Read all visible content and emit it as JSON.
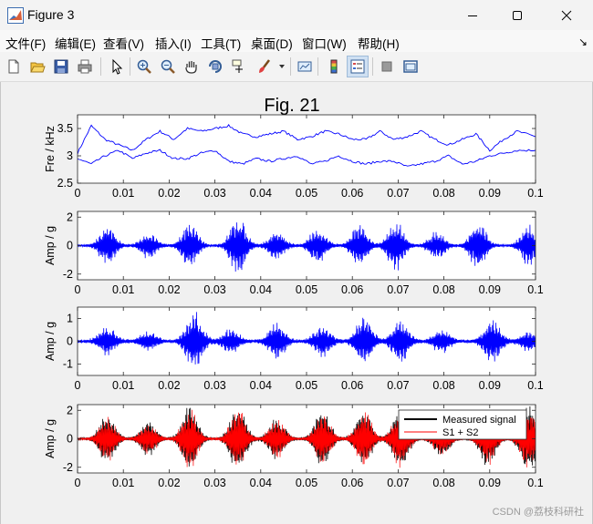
{
  "window": {
    "title": "Figure 3",
    "controls": {
      "minimize": "minimize-icon",
      "maximize": "maximize-icon",
      "close": "close-icon"
    }
  },
  "menu": [
    "文件(F)",
    "编辑(E)",
    "查看(V)",
    "插入(I)",
    "工具(T)",
    "桌面(D)",
    "窗口(W)",
    "帮助(H)"
  ],
  "toolbar": {
    "icons": [
      "new-figure-icon",
      "open-file-icon",
      "save-icon",
      "print-icon",
      "pointer-icon",
      "zoom-in-icon",
      "zoom-out-icon",
      "pan-icon",
      "rotate-3d-icon",
      "data-cursor-icon",
      "brush-icon",
      "brush-dropdown-icon",
      "link-plot-icon",
      "colorbar-icon",
      "legend-icon",
      "hide-plot-tools-icon",
      "show-plot-tools-icon"
    ]
  },
  "figure_title": "Fig. 21",
  "watermark": "CSDN @荔枝科研社",
  "chart_data": [
    {
      "type": "line",
      "ylabel": "Fre / kHz",
      "xlim": [
        0,
        0.1
      ],
      "ylim": [
        2.5,
        3.75
      ],
      "xticks": [
        "0",
        "0.01",
        "0.02",
        "0.03",
        "0.04",
        "0.05",
        "0.06",
        "0.07",
        "0.08",
        "0.09",
        "0.1"
      ],
      "yticks": [
        "2.5",
        "3",
        "3.5"
      ],
      "series": [
        {
          "color": "#0000ff",
          "x": [
            0,
            0.003,
            0.006,
            0.009,
            0.012,
            0.015,
            0.018,
            0.021,
            0.024,
            0.027,
            0.03,
            0.033,
            0.036,
            0.039,
            0.042,
            0.045,
            0.048,
            0.051,
            0.054,
            0.057,
            0.06,
            0.063,
            0.066,
            0.069,
            0.072,
            0.075,
            0.078,
            0.081,
            0.084,
            0.087,
            0.09,
            0.093,
            0.096,
            0.1
          ],
          "y": [
            3.05,
            3.55,
            3.3,
            3.2,
            3.1,
            3.3,
            3.45,
            3.3,
            3.5,
            3.45,
            3.5,
            3.55,
            3.4,
            3.35,
            3.4,
            3.45,
            3.3,
            3.35,
            3.45,
            3.4,
            3.3,
            3.3,
            3.45,
            3.3,
            3.35,
            3.45,
            3.3,
            3.2,
            3.3,
            3.4,
            3.1,
            3.3,
            3.45,
            3.35
          ]
        },
        {
          "color": "#0000ff",
          "x": [
            0,
            0.003,
            0.006,
            0.009,
            0.012,
            0.015,
            0.018,
            0.021,
            0.024,
            0.027,
            0.03,
            0.033,
            0.036,
            0.039,
            0.042,
            0.045,
            0.048,
            0.051,
            0.054,
            0.057,
            0.06,
            0.063,
            0.066,
            0.069,
            0.072,
            0.075,
            0.078,
            0.081,
            0.084,
            0.087,
            0.09,
            0.093,
            0.096,
            0.1
          ],
          "y": [
            2.95,
            2.85,
            3.0,
            3.1,
            2.95,
            3.05,
            3.1,
            2.95,
            2.95,
            3.05,
            3.1,
            2.9,
            2.85,
            2.95,
            2.9,
            2.95,
            3.0,
            2.85,
            2.9,
            3.0,
            2.9,
            2.85,
            2.9,
            2.9,
            2.8,
            2.85,
            2.9,
            3.0,
            2.85,
            2.9,
            3.0,
            3.05,
            3.1,
            3.1
          ]
        }
      ]
    },
    {
      "type": "line",
      "ylabel": "Amp / g",
      "xlim": [
        0,
        0.1
      ],
      "ylim": [
        -2.4,
        2.4
      ],
      "xticks": [
        "0",
        "0.01",
        "0.02",
        "0.03",
        "0.04",
        "0.05",
        "0.06",
        "0.07",
        "0.08",
        "0.09",
        "0.1"
      ],
      "yticks": [
        "-2",
        "0",
        "2"
      ],
      "series": [
        {
          "color": "#0000ff",
          "bursts": [
            {
              "x": 0.0065,
              "peak": 1.4
            },
            {
              "x": 0.0155,
              "peak": 0.9
            },
            {
              "x": 0.0245,
              "peak": 1.6
            },
            {
              "x": 0.035,
              "peak": 2.1
            },
            {
              "x": 0.0435,
              "peak": 1.0
            },
            {
              "x": 0.0525,
              "peak": 1.3
            },
            {
              "x": 0.0615,
              "peak": 1.5
            },
            {
              "x": 0.0695,
              "peak": 1.8
            },
            {
              "x": 0.0785,
              "peak": 1.0
            },
            {
              "x": 0.0875,
              "peak": 1.7
            },
            {
              "x": 0.0985,
              "peak": 1.4
            }
          ]
        }
      ]
    },
    {
      "type": "line",
      "ylabel": "Amp / g",
      "xlim": [
        0,
        0.1
      ],
      "ylim": [
        -1.5,
        1.5
      ],
      "xticks": [
        "0",
        "0.01",
        "0.02",
        "0.03",
        "0.04",
        "0.05",
        "0.06",
        "0.07",
        "0.08",
        "0.09",
        "0.1"
      ],
      "yticks": [
        "-1",
        "0",
        "1"
      ],
      "series": [
        {
          "color": "#0000ff",
          "bursts": [
            {
              "x": 0.0065,
              "peak": 0.6
            },
            {
              "x": 0.0155,
              "peak": 0.4
            },
            {
              "x": 0.0255,
              "peak": 1.3
            },
            {
              "x": 0.0335,
              "peak": 0.5
            },
            {
              "x": 0.0435,
              "peak": 0.8
            },
            {
              "x": 0.0535,
              "peak": 0.7
            },
            {
              "x": 0.0625,
              "peak": 1.1
            },
            {
              "x": 0.0705,
              "peak": 0.9
            },
            {
              "x": 0.0795,
              "peak": 0.5
            },
            {
              "x": 0.0905,
              "peak": 1.0
            },
            {
              "x": 0.0985,
              "peak": 0.4
            }
          ]
        }
      ]
    },
    {
      "type": "line",
      "ylabel": "Amp / g",
      "xlim": [
        0,
        0.1
      ],
      "ylim": [
        -2.4,
        2.4
      ],
      "xticks": [
        "0",
        "0.01",
        "0.02",
        "0.03",
        "0.04",
        "0.05",
        "0.06",
        "0.07",
        "0.08",
        "0.09",
        "0.1"
      ],
      "yticks": [
        "-2",
        "0",
        "2"
      ],
      "legend": {
        "location": "top-right",
        "entries": [
          {
            "label": "Measured signal",
            "color": "#000000"
          },
          {
            "label": "S1 + S2",
            "color": "#ff0000"
          }
        ]
      },
      "series": [
        {
          "name": "Measured signal",
          "color": "#000000",
          "bursts": [
            {
              "x": 0.0065,
              "peak": 1.8
            },
            {
              "x": 0.0155,
              "peak": 1.2
            },
            {
              "x": 0.0245,
              "peak": 2.3
            },
            {
              "x": 0.035,
              "peak": 2.4
            },
            {
              "x": 0.0435,
              "peak": 1.5
            },
            {
              "x": 0.0535,
              "peak": 2.0
            },
            {
              "x": 0.0625,
              "peak": 2.1
            },
            {
              "x": 0.0705,
              "peak": 2.2
            },
            {
              "x": 0.0795,
              "peak": 1.3
            },
            {
              "x": 0.0895,
              "peak": 2.0
            },
            {
              "x": 0.0985,
              "peak": 2.4
            }
          ]
        },
        {
          "name": "S1 + S2",
          "color": "#ff0000",
          "bursts": [
            {
              "x": 0.0065,
              "peak": 1.6
            },
            {
              "x": 0.0155,
              "peak": 1.1
            },
            {
              "x": 0.0245,
              "peak": 2.2
            },
            {
              "x": 0.035,
              "peak": 2.2
            },
            {
              "x": 0.0435,
              "peak": 1.4
            },
            {
              "x": 0.0535,
              "peak": 1.8
            },
            {
              "x": 0.0625,
              "peak": 2.0
            },
            {
              "x": 0.0705,
              "peak": 2.1
            },
            {
              "x": 0.0795,
              "peak": 1.2
            },
            {
              "x": 0.0895,
              "peak": 1.9
            },
            {
              "x": 0.0985,
              "peak": 2.2
            }
          ]
        }
      ]
    }
  ]
}
